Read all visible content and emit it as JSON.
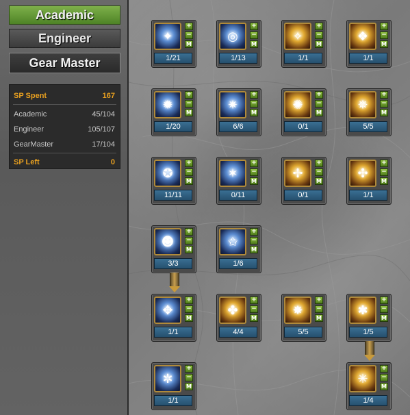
{
  "tabs": {
    "academic": "Academic",
    "engineer": "Engineer",
    "gear_master": "Gear Master"
  },
  "sp": {
    "spent_label": "SP Spent",
    "spent_value": "167",
    "academic_label": "Academic",
    "academic_value": "45/104",
    "engineer_label": "Engineer",
    "engineer_value": "105/107",
    "gearmaster_label": "GearMaster",
    "gearmaster_value": "17/104",
    "left_label": "SP Left",
    "left_value": "0"
  },
  "controls": {
    "plus": "+",
    "minus": "−",
    "max": "M"
  },
  "skills": [
    {
      "level": "1/21"
    },
    {
      "level": "1/13"
    },
    {
      "level": "1/1"
    },
    {
      "level": "1/1"
    },
    {
      "level": "1/20"
    },
    {
      "level": "6/6"
    },
    {
      "level": "0/1"
    },
    {
      "level": "5/5"
    },
    {
      "level": "11/11"
    },
    {
      "level": "0/11"
    },
    {
      "level": "0/1"
    },
    {
      "level": "1/1"
    },
    {
      "level": "3/3"
    },
    {
      "level": "1/6"
    },
    {
      "level": "1/1"
    },
    {
      "level": "4/4"
    },
    {
      "level": "5/5"
    },
    {
      "level": "1/5"
    },
    {
      "level": "1/1"
    },
    {
      "level": "1/4"
    }
  ],
  "colors": {
    "academic_tab": "#5e9a30",
    "sp_gold": "#e8a020",
    "level_bar": "#2f5f80",
    "control_green": "#6a9e2c"
  }
}
